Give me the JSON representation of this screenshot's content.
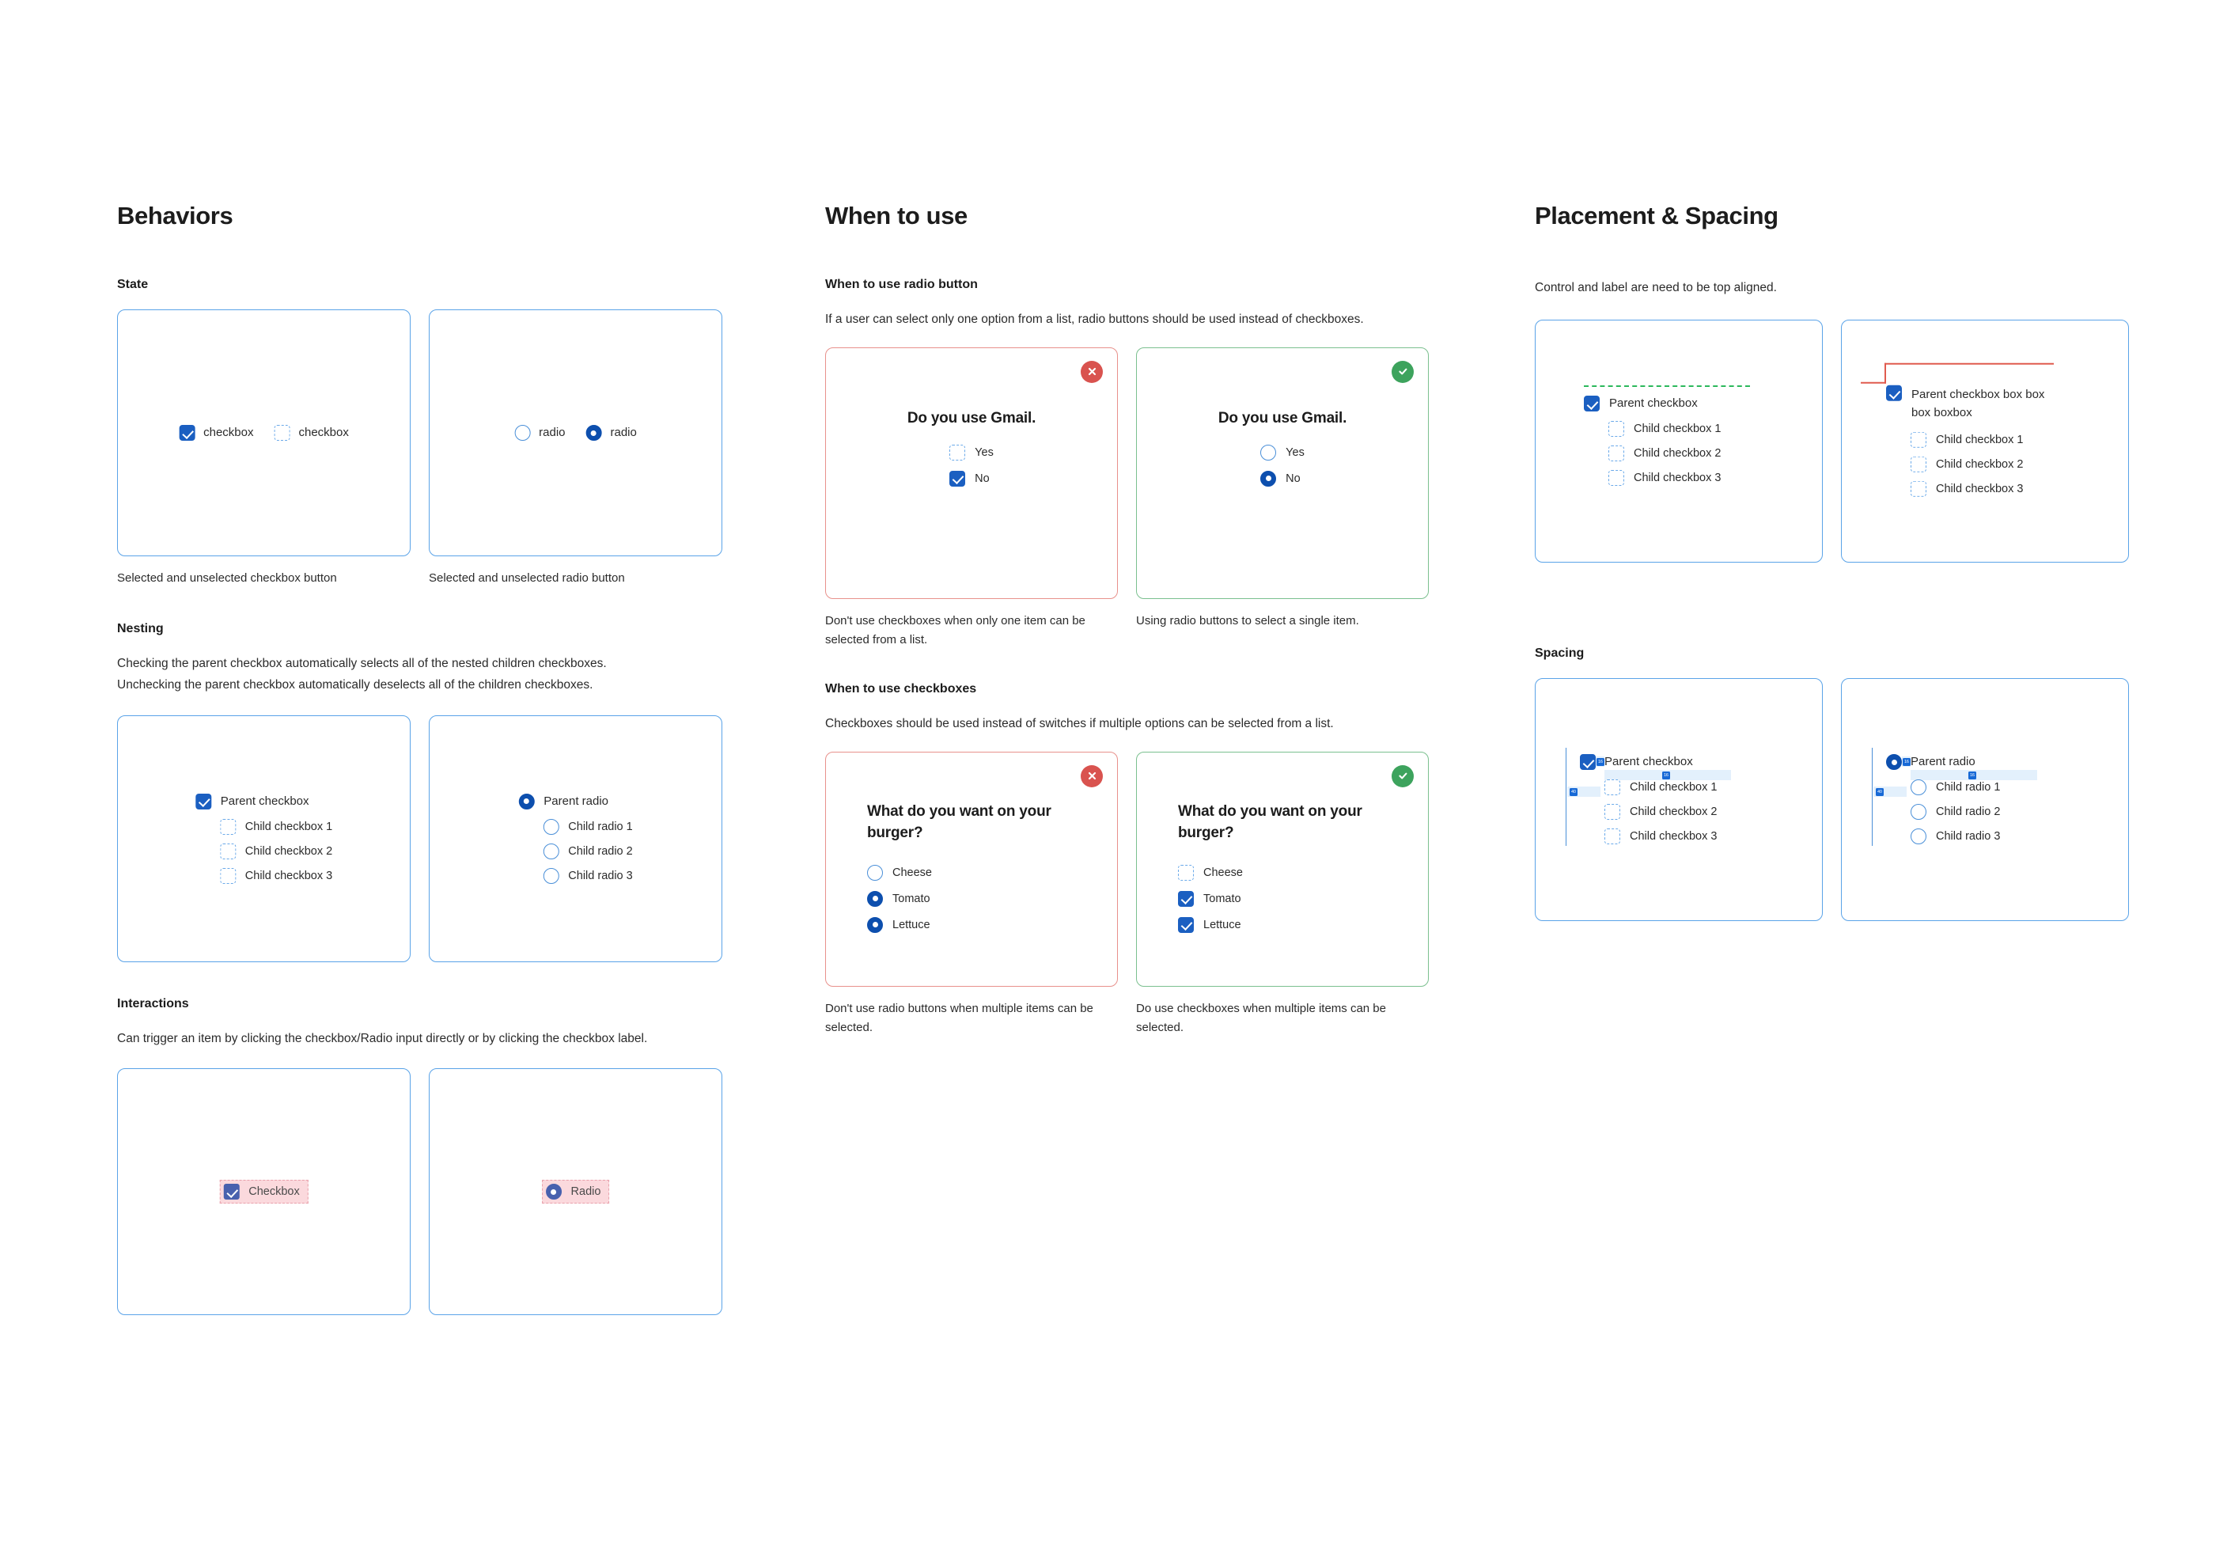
{
  "columns": {
    "behaviors": {
      "title": "Behaviors",
      "sections": {
        "state": {
          "heading": "State",
          "checkbox_demo": {
            "selected_label": "checkbox",
            "unselected_label": "checkbox"
          },
          "radio_demo": {
            "unselected_label": "radio",
            "selected_label": "radio"
          },
          "caption_left": "Selected and unselected checkbox button",
          "caption_right": "Selected and unselected radio button"
        },
        "nesting": {
          "heading": "Nesting",
          "body_line_1": "Checking the parent checkbox automatically selects all of the nested children checkboxes.",
          "body_line_2": "Unchecking the parent checkbox automatically deselects all of the children checkboxes.",
          "checkbox_tree": {
            "parent": "Parent checkbox",
            "children": [
              "Child checkbox 1",
              "Child checkbox 2",
              "Child checkbox 3"
            ]
          },
          "radio_tree": {
            "parent": "Parent radio",
            "children": [
              "Child radio 1",
              "Child radio 2",
              "Child radio 3"
            ]
          }
        },
        "interactions": {
          "heading": "Interactions",
          "body": "Can trigger an item by clicking the checkbox/Radio input directly or by clicking the checkbox label.",
          "checkbox_label": "Checkbox",
          "radio_label": "Radio"
        }
      }
    },
    "when_to_use": {
      "title": "When to use",
      "sections": {
        "radio": {
          "heading": "When to use radio button",
          "body": "If a user can select only one option from a list, radio buttons should be used instead of checkboxes.",
          "bad_card": {
            "badge": "x-icon",
            "question": "Do you use Gmail.",
            "options": [
              {
                "label": "Yes",
                "checked": false
              },
              {
                "label": "No",
                "checked": true
              }
            ]
          },
          "good_card": {
            "badge": "check-icon",
            "question": "Do you use Gmail.",
            "options": [
              {
                "label": "Yes",
                "checked": false
              },
              {
                "label": "No",
                "checked": true
              }
            ]
          },
          "caption_bad": "Don't use checkboxes when only one item can be selected from a list.",
          "caption_good": "Using radio buttons to select a single item."
        },
        "checkboxes": {
          "heading": "When  to use checkboxes",
          "body": "Checkboxes should be used instead of switches if multiple options can be selected from a list.",
          "bad_card": {
            "badge": "x-icon",
            "question": "What  do you want on your burger?",
            "options": [
              {
                "label": "Cheese",
                "checked": false
              },
              {
                "label": "Tomato",
                "checked": true
              },
              {
                "label": "Lettuce",
                "checked": true
              }
            ]
          },
          "good_card": {
            "badge": "check-icon",
            "question": "What  do you want on your burger?",
            "options": [
              {
                "label": "Cheese",
                "checked": false
              },
              {
                "label": "Tomato",
                "checked": true
              },
              {
                "label": "Lettuce",
                "checked": true
              }
            ]
          },
          "caption_bad": "Don't use radio buttons when multiple items can be selected.",
          "caption_good": "Do use checkboxes when multiple items can be selected."
        }
      }
    },
    "placement": {
      "title": "Placement & Spacing",
      "sections": {
        "alignment": {
          "body": "Control and label are need to be top aligned.",
          "good_card": {
            "parent": "Parent checkbox",
            "children": [
              "Child checkbox 1",
              "Child checkbox 2",
              "Child checkbox 3"
            ]
          },
          "bad_card": {
            "parent": "Parent checkbox box box box boxbox",
            "children": [
              "Child checkbox 1",
              "Child checkbox 2",
              "Child checkbox 3"
            ]
          }
        },
        "spacing": {
          "heading": "Spacing",
          "checkbox_card": {
            "parent": "Parent checkbox",
            "children": [
              "Child checkbox 1",
              "Child checkbox 2",
              "Child checkbox 3"
            ],
            "gap_control_label": "16",
            "gap_parent_child": "16",
            "gap_indent": "40"
          },
          "radio_card": {
            "parent": "Parent radio",
            "children": [
              "Child radio 1",
              "Child radio 2",
              "Child radio 3"
            ],
            "gap_control_label": "16",
            "gap_parent_child": "16",
            "gap_indent": "40"
          }
        }
      }
    }
  },
  "colors": {
    "accent_blue": "#1b5fc1",
    "radio_blue": "#0d4fae",
    "card_border": "#5aa3e8",
    "bad_border": "#e8918c",
    "good_border": "#7bc08f",
    "bad_badge": "#d9534f",
    "good_badge": "#3da35d",
    "highlight_pink": "#fbd9dd",
    "align_good": "#2cb85c",
    "align_bad": "#e05b4f",
    "measure_blue": "#1769d6"
  }
}
